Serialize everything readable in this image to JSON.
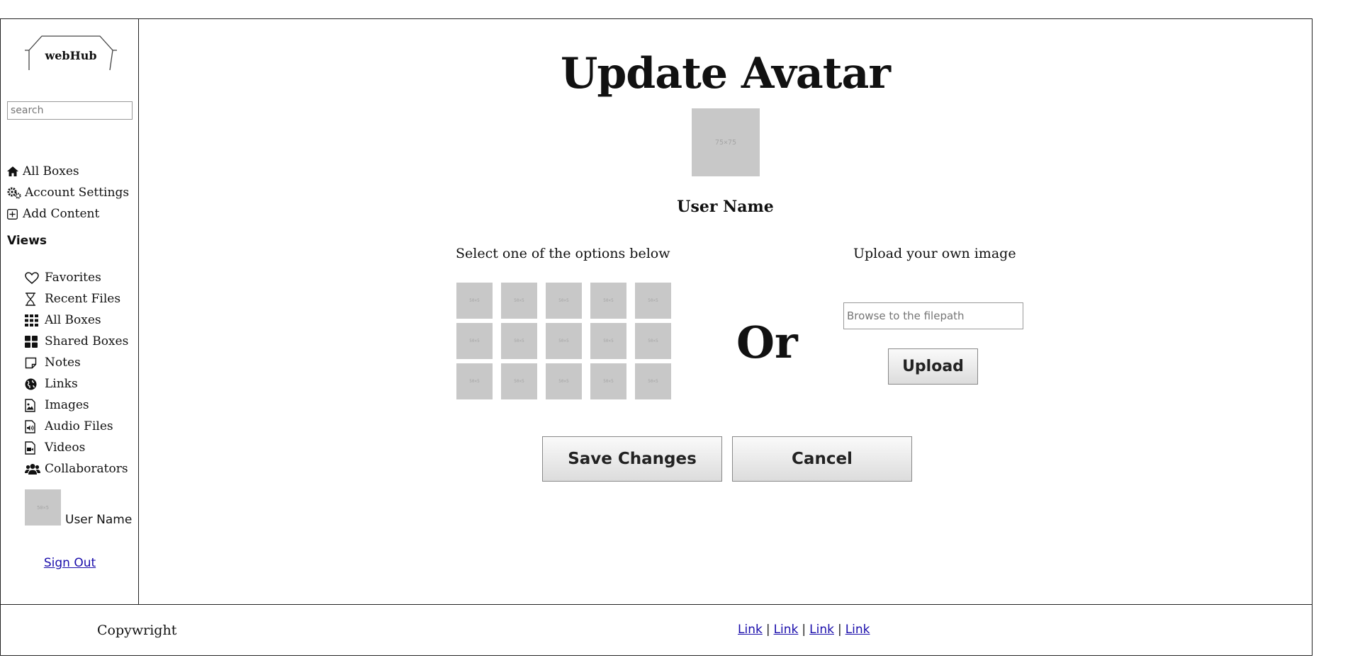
{
  "logo": {
    "text": "webHub"
  },
  "search": {
    "placeholder": "search"
  },
  "nav": [
    {
      "label": "All Boxes",
      "icon": "home-icon"
    },
    {
      "label": "Account Settings",
      "icon": "gears-icon"
    },
    {
      "label": "Add Content",
      "icon": "plus-square-icon"
    }
  ],
  "views": {
    "title": "Views",
    "items": [
      {
        "label": "Favorites",
        "icon": "heart-icon"
      },
      {
        "label": "Recent Files",
        "icon": "hourglass-icon"
      },
      {
        "label": "All Boxes",
        "icon": "grid-icon"
      },
      {
        "label": "Shared Boxes",
        "icon": "tiles-icon"
      },
      {
        "label": "Notes",
        "icon": "note-icon"
      },
      {
        "label": "Links",
        "icon": "globe-icon"
      },
      {
        "label": "Images",
        "icon": "image-file-icon"
      },
      {
        "label": "Audio Files",
        "icon": "audio-file-icon"
      },
      {
        "label": "Videos",
        "icon": "video-file-icon"
      },
      {
        "label": "Collaborators",
        "icon": "users-icon"
      }
    ]
  },
  "sidebar_user": {
    "name": "User Name",
    "avatar_text": "50×5",
    "sign_out": "Sign Out"
  },
  "main": {
    "title": "Update Avatar",
    "avatar_text": "75×75",
    "username": "User Name",
    "select_label": "Select one of the options below",
    "upload_label": "Upload your own image",
    "or_text": "Or",
    "filepath_placeholder": "Browse to the filepath",
    "upload_button": "Upload",
    "save_button": "Save Changes",
    "cancel_button": "Cancel",
    "option_thumb_text": "50×5"
  },
  "footer": {
    "copyright": "Copywright",
    "links": [
      "Link",
      "Link",
      "Link",
      "Link"
    ]
  }
}
